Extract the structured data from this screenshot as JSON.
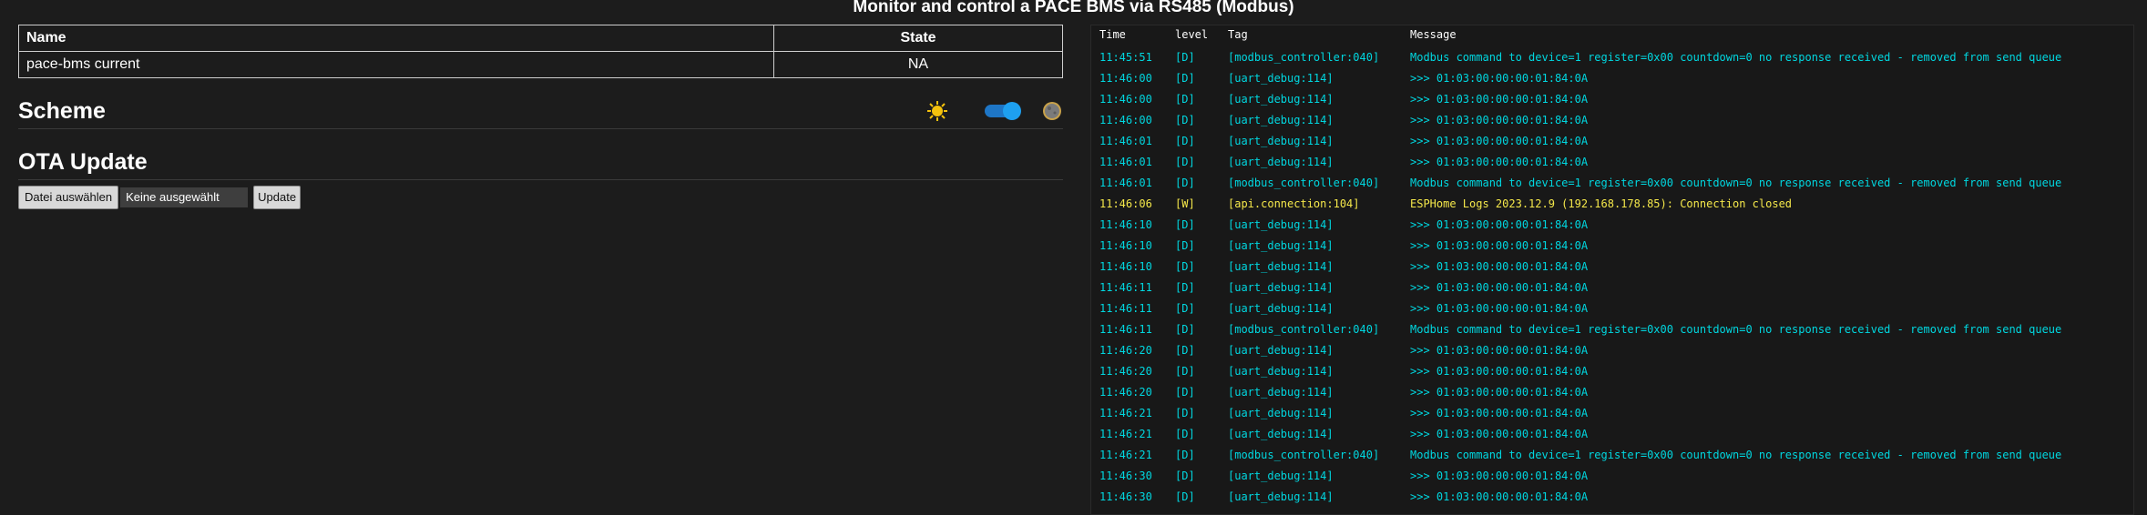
{
  "page": {
    "title": "Monitor and control a PACE BMS via RS485 (Modbus)"
  },
  "states_table": {
    "headers": {
      "name": "Name",
      "state": "State"
    },
    "rows": [
      {
        "name": "pace-bms current",
        "state": "NA"
      }
    ]
  },
  "scheme": {
    "title": "Scheme",
    "sun_icon": "sun-icon",
    "moon_icon": "moon-icon",
    "dark_mode": true
  },
  "ota": {
    "title": "OTA Update",
    "choose_file_label": "Datei auswählen",
    "no_file_label": "Keine ausgewählt",
    "update_label": "Update"
  },
  "log": {
    "headers": {
      "time": "Time",
      "level": "level",
      "tag": "Tag",
      "message": "Message"
    },
    "colors": {
      "debug": "#00d7e0",
      "warning": "#f5e84a"
    },
    "rows": [
      {
        "time": "11:45:51",
        "level": "[D]",
        "tag": "[modbus_controller:040]",
        "message": "Modbus command to device=1 register=0x00 countdown=0 no response received - removed from send queue"
      },
      {
        "time": "11:46:00",
        "level": "[D]",
        "tag": "[uart_debug:114]",
        "message": ">>> 01:03:00:00:00:01:84:0A"
      },
      {
        "time": "11:46:00",
        "level": "[D]",
        "tag": "[uart_debug:114]",
        "message": ">>> 01:03:00:00:00:01:84:0A"
      },
      {
        "time": "11:46:00",
        "level": "[D]",
        "tag": "[uart_debug:114]",
        "message": ">>> 01:03:00:00:00:01:84:0A"
      },
      {
        "time": "11:46:01",
        "level": "[D]",
        "tag": "[uart_debug:114]",
        "message": ">>> 01:03:00:00:00:01:84:0A"
      },
      {
        "time": "11:46:01",
        "level": "[D]",
        "tag": "[uart_debug:114]",
        "message": ">>> 01:03:00:00:00:01:84:0A"
      },
      {
        "time": "11:46:01",
        "level": "[D]",
        "tag": "[modbus_controller:040]",
        "message": "Modbus command to device=1 register=0x00 countdown=0 no response received - removed from send queue"
      },
      {
        "time": "11:46:06",
        "level": "[W]",
        "tag": "[api.connection:104]",
        "message": "ESPHome Logs 2023.12.9 (192.168.178.85): Connection closed"
      },
      {
        "time": "11:46:10",
        "level": "[D]",
        "tag": "[uart_debug:114]",
        "message": ">>> 01:03:00:00:00:01:84:0A"
      },
      {
        "time": "11:46:10",
        "level": "[D]",
        "tag": "[uart_debug:114]",
        "message": ">>> 01:03:00:00:00:01:84:0A"
      },
      {
        "time": "11:46:10",
        "level": "[D]",
        "tag": "[uart_debug:114]",
        "message": ">>> 01:03:00:00:00:01:84:0A"
      },
      {
        "time": "11:46:11",
        "level": "[D]",
        "tag": "[uart_debug:114]",
        "message": ">>> 01:03:00:00:00:01:84:0A"
      },
      {
        "time": "11:46:11",
        "level": "[D]",
        "tag": "[uart_debug:114]",
        "message": ">>> 01:03:00:00:00:01:84:0A"
      },
      {
        "time": "11:46:11",
        "level": "[D]",
        "tag": "[modbus_controller:040]",
        "message": "Modbus command to device=1 register=0x00 countdown=0 no response received - removed from send queue"
      },
      {
        "time": "11:46:20",
        "level": "[D]",
        "tag": "[uart_debug:114]",
        "message": ">>> 01:03:00:00:00:01:84:0A"
      },
      {
        "time": "11:46:20",
        "level": "[D]",
        "tag": "[uart_debug:114]",
        "message": ">>> 01:03:00:00:00:01:84:0A"
      },
      {
        "time": "11:46:20",
        "level": "[D]",
        "tag": "[uart_debug:114]",
        "message": ">>> 01:03:00:00:00:01:84:0A"
      },
      {
        "time": "11:46:21",
        "level": "[D]",
        "tag": "[uart_debug:114]",
        "message": ">>> 01:03:00:00:00:01:84:0A"
      },
      {
        "time": "11:46:21",
        "level": "[D]",
        "tag": "[uart_debug:114]",
        "message": ">>> 01:03:00:00:00:01:84:0A"
      },
      {
        "time": "11:46:21",
        "level": "[D]",
        "tag": "[modbus_controller:040]",
        "message": "Modbus command to device=1 register=0x00 countdown=0 no response received - removed from send queue"
      },
      {
        "time": "11:46:30",
        "level": "[D]",
        "tag": "[uart_debug:114]",
        "message": ">>> 01:03:00:00:00:01:84:0A"
      },
      {
        "time": "11:46:30",
        "level": "[D]",
        "tag": "[uart_debug:114]",
        "message": ">>> 01:03:00:00:00:01:84:0A"
      }
    ]
  }
}
